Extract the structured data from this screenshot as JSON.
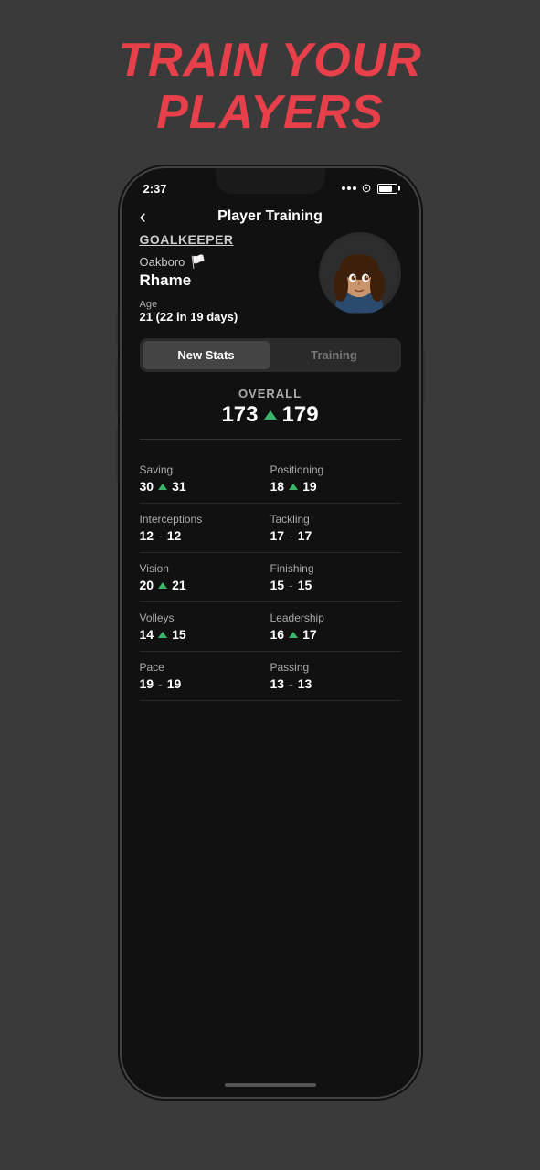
{
  "headline": {
    "line1": "TRAIN YOUR",
    "line2": "PLAYERS"
  },
  "status_bar": {
    "time": "2:37",
    "dots": 3
  },
  "nav": {
    "title": "Player Training",
    "back_label": "‹"
  },
  "player": {
    "position": "GOALKEEPER",
    "club": "Oakboro",
    "name": "Rhame",
    "age_label": "Age",
    "age_value": "21 (22 in 19 days)"
  },
  "tabs": [
    {
      "label": "New Stats",
      "active": true
    },
    {
      "label": "Training",
      "active": false
    }
  ],
  "overall": {
    "label": "OVERALL",
    "old_value": "173",
    "new_value": "179"
  },
  "stats": [
    {
      "name": "Saving",
      "old": "30",
      "new": "31",
      "arrow": true,
      "col": 0
    },
    {
      "name": "Positioning",
      "old": "18",
      "new": "19",
      "arrow": true,
      "col": 1
    },
    {
      "name": "Interceptions",
      "old": "12",
      "dash": true,
      "new": "12",
      "arrow": false,
      "col": 0
    },
    {
      "name": "Tackling",
      "old": "17",
      "dash": true,
      "new": "17",
      "arrow": false,
      "col": 1
    },
    {
      "name": "Vision",
      "old": "20",
      "new": "21",
      "arrow": true,
      "col": 0
    },
    {
      "name": "Finishing",
      "old": "15",
      "dash": true,
      "new": "15",
      "arrow": false,
      "col": 1
    },
    {
      "name": "Volleys",
      "old": "14",
      "new": "15",
      "arrow": true,
      "col": 0
    },
    {
      "name": "Leadership",
      "old": "16",
      "new": "17",
      "arrow": true,
      "col": 1
    },
    {
      "name": "Pace",
      "old": "19",
      "dash": true,
      "new": "19",
      "arrow": false,
      "col": 0
    },
    {
      "name": "Passing",
      "old": "13",
      "dash": true,
      "new": "13",
      "arrow": false,
      "col": 1
    }
  ]
}
